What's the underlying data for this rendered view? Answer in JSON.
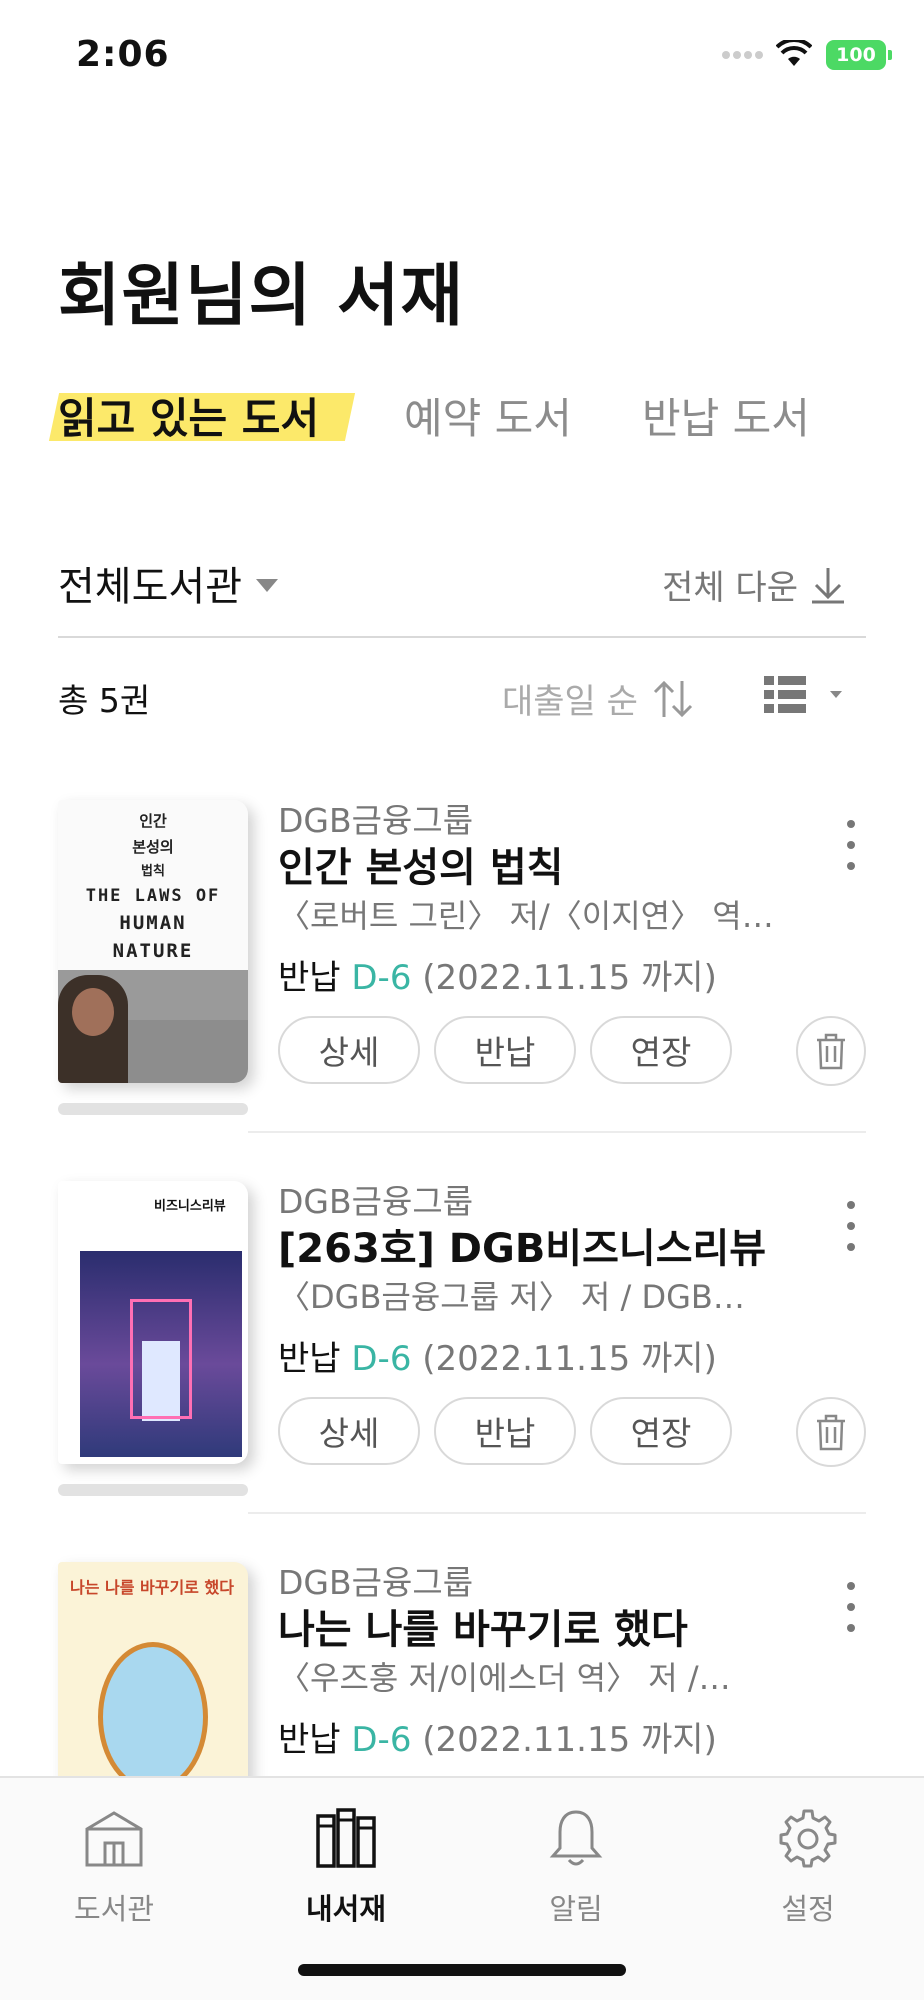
{
  "status_bar": {
    "time": "2:06",
    "battery": "100"
  },
  "page_title": "회원님의 서재",
  "tabs": [
    {
      "label": "읽고 있는 도서",
      "active": true
    },
    {
      "label": "예약 도서",
      "active": false
    },
    {
      "label": "반납 도서",
      "active": false
    }
  ],
  "filter": {
    "library": "전체도서관",
    "download_all": "전체 다운"
  },
  "list_header": {
    "count": "총 5권",
    "sort": "대출일 순"
  },
  "buttons": {
    "detail": "상세",
    "return": "반납",
    "extend": "연장"
  },
  "books": [
    {
      "publisher": "DGB금융그룹",
      "title": "인간 본성의 법칙",
      "author": "〈로버트 그린〉 저/〈이지연〉 역…",
      "status": "반납",
      "d_day": "D-6",
      "due_date": "(2022.11.15 까지)",
      "cover": {
        "line1": "인간",
        "line2": "본성의",
        "line3": "법칙",
        "en1": "THE LAWS OF",
        "en2": "HUMAN",
        "en3": "NATURE"
      }
    },
    {
      "publisher": "DGB금융그룹",
      "title": "[263호] DGB비즈니스리뷰",
      "author": "〈DGB금융그룹 저〉 저 / DGB…",
      "status": "반납",
      "d_day": "D-6",
      "due_date": "(2022.11.15 까지)",
      "cover": {
        "logo": "비즈니스리뷰"
      }
    },
    {
      "publisher": "DGB금융그룹",
      "title": "나는 나를 바꾸기로 했다",
      "author": "〈우즈훙 저/이에스더 역〉 저 /…",
      "status": "반납",
      "d_day": "D-6",
      "due_date": "(2022.11.15 까지)",
      "cover": {
        "title": "나는 나를 바꾸기로 했다"
      }
    }
  ],
  "bottom_nav": [
    {
      "label": "도서관",
      "icon": "library-icon",
      "active": false
    },
    {
      "label": "내서재",
      "icon": "bookshelf-icon",
      "active": true
    },
    {
      "label": "알림",
      "icon": "bell-icon",
      "active": false
    },
    {
      "label": "설정",
      "icon": "gear-icon",
      "active": false
    }
  ],
  "colors": {
    "accent_teal": "#3ab5a4",
    "tab_highlight": "#fce96a",
    "battery": "#4cd964"
  }
}
